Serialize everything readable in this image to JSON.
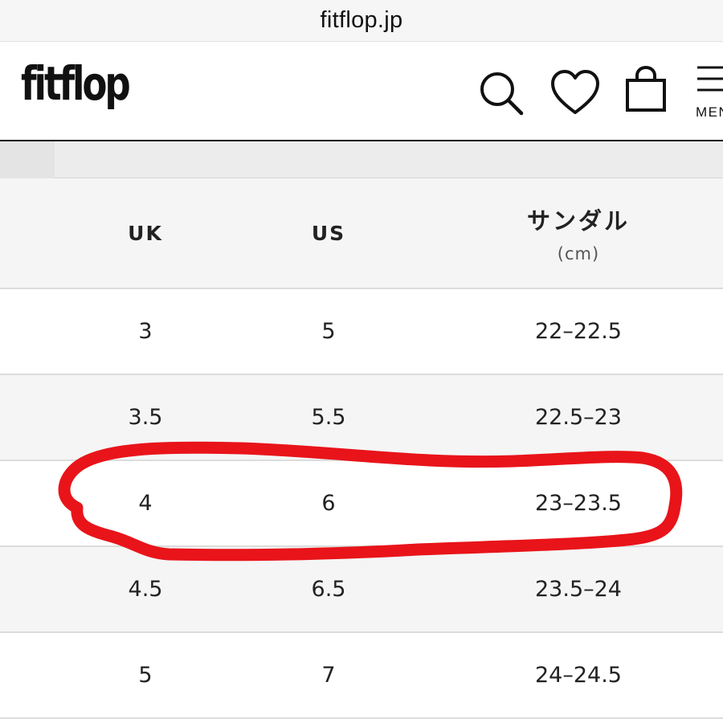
{
  "browser": {
    "url": "fitflop.jp"
  },
  "header": {
    "logo": "fitflop",
    "menu_label": "MENU",
    "icons": [
      "search-icon",
      "heart-icon",
      "shopping-bag-icon",
      "hamburger-menu-icon"
    ]
  },
  "size_table": {
    "headers": {
      "uk": "UK",
      "us": "US",
      "sandal": "サンダル",
      "sandal_unit": "(cm)"
    },
    "rows": [
      {
        "uk": "3",
        "us": "5",
        "cm": "22–22.5"
      },
      {
        "uk": "3.5",
        "us": "5.5",
        "cm": "22.5–23"
      },
      {
        "uk": "4",
        "us": "6",
        "cm": "23–23.5"
      },
      {
        "uk": "4.5",
        "us": "6.5",
        "cm": "23.5–24"
      },
      {
        "uk": "5",
        "us": "7",
        "cm": "24–24.5"
      }
    ],
    "highlighted_row": 2
  },
  "colors": {
    "highlight_stroke": "#e8141a",
    "row_alt": "#f5f5f5",
    "text": "#222222"
  }
}
